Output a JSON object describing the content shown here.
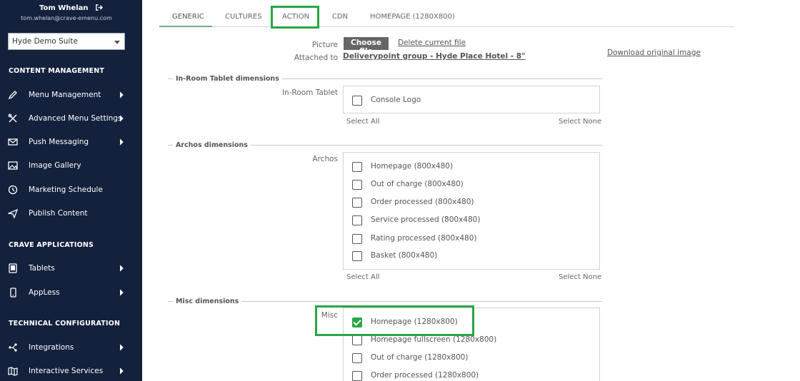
{
  "user": {
    "name": "Tom Whelan",
    "email": "tom.whelan@crave-emenu.com"
  },
  "suite_select": {
    "value": "Hyde Demo Suite"
  },
  "sidebar": {
    "sections": [
      {
        "title": "CONTENT MANAGEMENT"
      },
      {
        "title": "CRAVE APPLICATIONS"
      },
      {
        "title": "TECHNICAL CONFIGURATION"
      }
    ],
    "items": [
      {
        "label": "Menu Management",
        "icon": "pencil-icon"
      },
      {
        "label": "Advanced Menu Settings",
        "icon": "tools-icon"
      },
      {
        "label": "Push Messaging",
        "icon": "envelope-icon"
      },
      {
        "label": "Image Gallery",
        "icon": "image-icon"
      },
      {
        "label": "Marketing Schedule",
        "icon": "clock-icon"
      },
      {
        "label": "Publish Content",
        "icon": "paper-plane-icon"
      },
      {
        "label": "Tablets",
        "icon": "tablet-icon"
      },
      {
        "label": "AppLess",
        "icon": "phone-icon"
      },
      {
        "label": "Integrations",
        "icon": "network-icon"
      },
      {
        "label": "Interactive Services",
        "icon": "map-icon"
      }
    ]
  },
  "tabs": [
    {
      "label": "GENERIC"
    },
    {
      "label": "CULTURES"
    },
    {
      "label": "ACTION"
    },
    {
      "label": "CDN"
    },
    {
      "label": "HOMEPAGE (1280X800)"
    }
  ],
  "picture": {
    "label": "Picture",
    "choose_label": "Choose file",
    "delete_label": "Delete current file",
    "attached_label": "Attached to",
    "attached_value": "Deliverypoint group - Hyde Place Hotel - 8\"",
    "download_label": "Download original image"
  },
  "sections": {
    "inroom": {
      "title": "In-Room Tablet dimensions",
      "label": "In-Room Tablet",
      "options": [
        "Console Logo"
      ],
      "select_all": "Select All",
      "select_none": "Select None"
    },
    "archos": {
      "title": "Archos dimensions",
      "label": "Archos",
      "options": [
        "Homepage (800x480)",
        "Out of charge (800x480)",
        "Order processed (800x480)",
        "Service processed (800x480)",
        "Rating processed (800x480)",
        "Basket (800x480)"
      ],
      "select_all": "Select All",
      "select_none": "Select None"
    },
    "misc": {
      "title": "Misc dimensions",
      "label": "Misc",
      "options": [
        "Homepage (1280x800)",
        "Homepage fullscreen (1280x800)",
        "Out of charge (1280x800)",
        "Order processed (1280x800)"
      ],
      "checked": [
        true,
        false,
        false,
        false
      ]
    }
  },
  "colors": {
    "sidebar_bg": "#14213d",
    "highlight": "#28a745",
    "tab_underline": "#6ab187"
  }
}
